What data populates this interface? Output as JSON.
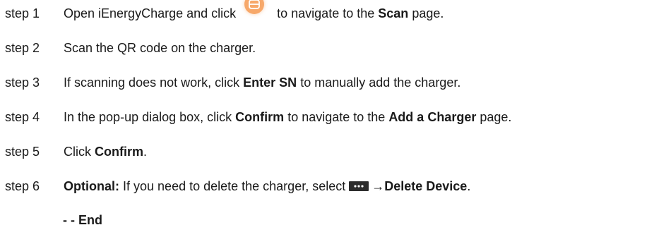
{
  "steps": [
    {
      "label": "step 1",
      "pre": "Open iEnergyCharge and click",
      "icon": "scan-icon",
      "mid": "to navigate to the",
      "bold": "Scan",
      "post": "page."
    },
    {
      "label": "step 2",
      "text": "Scan the QR code on the charger."
    },
    {
      "label": "step 3",
      "pre": "If scanning does not work, click",
      "bold": "Enter SN",
      "post": "to manually add the charger."
    },
    {
      "label": "step 4",
      "pre": "In the pop-up dialog box, click",
      "bold1": "Confirm",
      "mid": "to navigate to the",
      "bold2": "Add a Charger",
      "post": "page."
    },
    {
      "label": "step 5",
      "pre": "Click",
      "bold": "Confirm",
      "post": "."
    },
    {
      "label": "step 6",
      "bold_lead": "Optional:",
      "pre": "If you need to delete the charger, select",
      "icon": "more-icon",
      "arrow": "→",
      "bold": "Delete Device",
      "post": "."
    }
  ],
  "end": "- - End",
  "colors": {
    "text": "#1a1a1a",
    "scan_icon": "#f7a86a",
    "more_icon": "#2c2c2c"
  }
}
